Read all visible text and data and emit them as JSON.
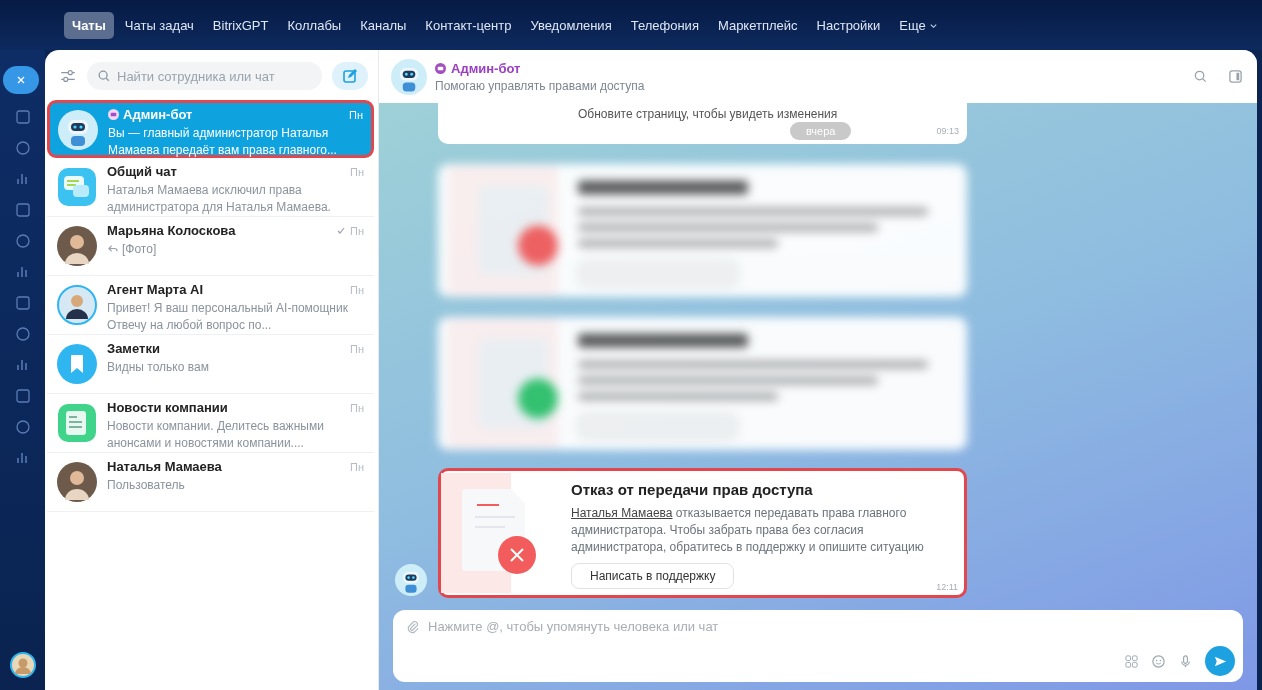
{
  "nav": {
    "tabs": [
      {
        "label": "Чаты",
        "selected": true
      },
      {
        "label": "Чаты задач",
        "selected": false
      },
      {
        "label": "BitrixGPT",
        "selected": false
      },
      {
        "label": "Коллабы",
        "selected": false
      },
      {
        "label": "Каналы",
        "selected": false
      },
      {
        "label": "Контакт-центр",
        "selected": false
      },
      {
        "label": "Уведомления",
        "selected": false
      },
      {
        "label": "Телефония",
        "selected": false
      },
      {
        "label": "Маркетплейс",
        "selected": false
      },
      {
        "label": "Настройки",
        "selected": false
      },
      {
        "label": "Еще",
        "selected": false,
        "dropdown": true
      }
    ]
  },
  "chat_list": {
    "search": {
      "placeholder": "Найти сотрудника или чат"
    },
    "chats": [
      {
        "name": "Админ-бот",
        "bot": true,
        "kind": "bot",
        "preview": "Вы — главный администратор Наталья Мамаева передаёт вам права главного...",
        "time": "Пн",
        "selected": true,
        "read": false,
        "reply": false
      },
      {
        "name": "Общий чат",
        "bot": false,
        "kind": "group",
        "preview": "Наталья Мамаева исключил права администратора для Наталья Мамаева.",
        "time": "Пн",
        "selected": false,
        "read": false,
        "reply": false
      },
      {
        "name": "Марьяна Колоскова",
        "bot": false,
        "kind": "person",
        "preview": "[Фото]",
        "time": "Пн",
        "selected": false,
        "read": true,
        "reply": true
      },
      {
        "name": "Агент Марта AI",
        "bot": false,
        "kind": "agent",
        "preview": "Привет! Я ваш персональный AI-помощник Отвечу на любой вопрос по...",
        "time": "Пн",
        "selected": false,
        "read": false,
        "reply": false
      },
      {
        "name": "Заметки",
        "bot": false,
        "kind": "notes",
        "preview": "Видны только вам",
        "time": "Пн",
        "selected": false,
        "read": false,
        "reply": false
      },
      {
        "name": "Новости компании",
        "bot": false,
        "kind": "news",
        "preview": "Новости компании. Делитесь важными анонсами и новостями компании....",
        "time": "Пн",
        "selected": false,
        "read": false,
        "reply": false
      },
      {
        "name": "Наталья Мамаева",
        "bot": false,
        "kind": "person",
        "preview": "Пользователь",
        "time": "Пн",
        "selected": false,
        "read": false,
        "reply": false
      }
    ]
  },
  "chat": {
    "title": "Админ-бот",
    "bot": true,
    "subtitle": "Помогаю управлять правами доступа",
    "messages": [
      {
        "kind": "partial",
        "text": "Обновите страницу, чтобы увидеть изменения",
        "date": "вчера",
        "time": "09:13"
      },
      {
        "kind": "blurred",
        "color": "#f25c5c"
      },
      {
        "kind": "blurred",
        "color": "#2fc26b"
      },
      {
        "kind": "card",
        "highlighted": true,
        "title": "Отказ от передачи прав доступа",
        "author": "Наталья Мамаева",
        "text": "отказывается передавать права главного администратора. Чтобы забрать права без согласия администратора, обратитесь в поддержку и опишите ситуацию",
        "button": "Написать в поддержку",
        "time": "12:11"
      }
    ],
    "input": {
      "placeholder": "Нажмите @, чтобы упомянуть человека или чат"
    }
  }
}
